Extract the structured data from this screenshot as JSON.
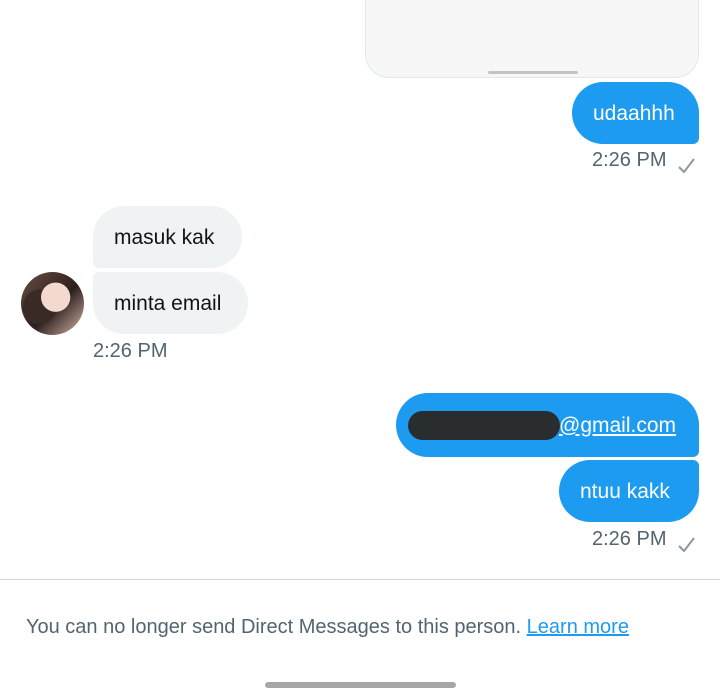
{
  "messages": {
    "m1": "udaahhh",
    "m2": "masuk kak",
    "m3": "minta email",
    "m4_email_suffix": "@gmail.com",
    "m5": "ntuu kakk"
  },
  "timestamps": {
    "t1": "2:26 PM",
    "t2": "2:26 PM",
    "t3": "2:26 PM"
  },
  "footer": {
    "notice_text": "You can no longer send Direct Messages to this person.",
    "learn_more": "Learn more"
  },
  "colors": {
    "outgoing_bubble": "#1d9bf0",
    "incoming_bubble": "#eff3f4",
    "link": "#1d9bf0"
  },
  "icons": [
    "sent-check-icon",
    "avatar"
  ]
}
